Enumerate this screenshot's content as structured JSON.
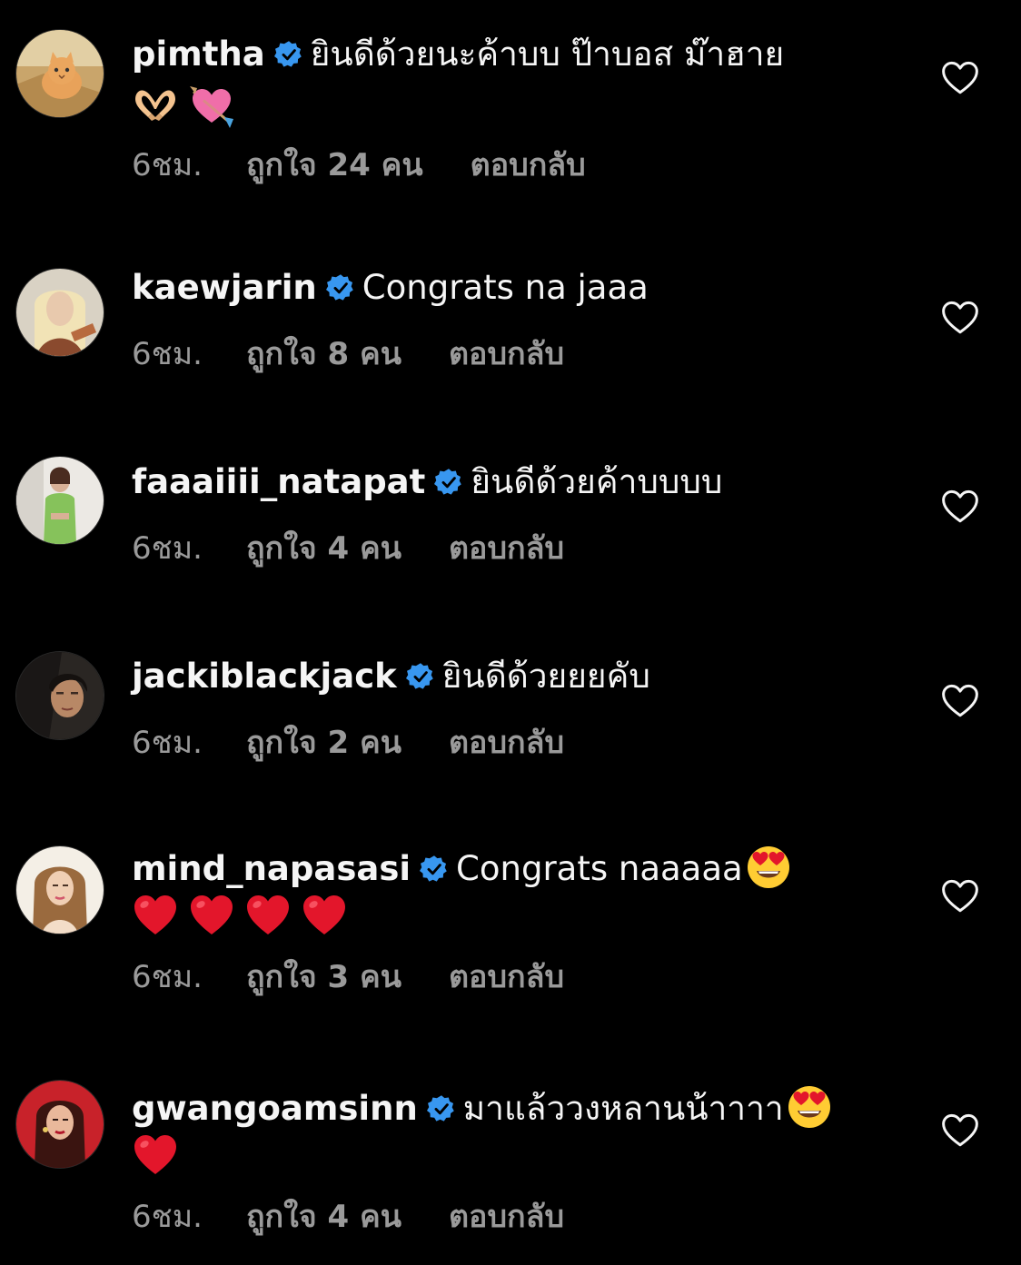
{
  "comments": [
    {
      "username": "pimtha",
      "text": "ยินดีด้วยนะค้าบบ ป๊าบอส ม๊าฮาย",
      "emojis_line2": [
        "heart-hands-emoji",
        "heart-with-arrow-emoji"
      ],
      "time": "6ชม.",
      "likes": "ถูกใจ 24 คน",
      "reply": "ตอบกลับ"
    },
    {
      "username": "kaewjarin",
      "text": "Congrats na jaaa",
      "time": "6ชม.",
      "likes": "ถูกใจ 8 คน",
      "reply": "ตอบกลับ"
    },
    {
      "username": "faaaiiii_natapat",
      "text": "ยินดีด้วยค้าบบบบ",
      "time": "6ชม.",
      "likes": "ถูกใจ 4 คน",
      "reply": "ตอบกลับ"
    },
    {
      "username": "jackiblackjack",
      "text": "ยินดีด้วยยยคับ",
      "time": "6ชม.",
      "likes": "ถูกใจ 2 คน",
      "reply": "ตอบกลับ"
    },
    {
      "username": "mind_napasasi",
      "text": "Congrats naaaaa",
      "emojis_inline": [
        "heart-eyes-emoji"
      ],
      "emojis_line2": [
        "red-heart-emoji",
        "red-heart-emoji",
        "red-heart-emoji",
        "red-heart-emoji"
      ],
      "time": "6ชม.",
      "likes": "ถูกใจ 3 คน",
      "reply": "ตอบกลับ"
    },
    {
      "username": "gwangoamsinn",
      "text": "มาแล้ววงหลานน้าาาา",
      "emojis_inline": [
        "heart-eyes-emoji"
      ],
      "emojis_line2": [
        "red-heart-emoji"
      ],
      "time": "6ชม.",
      "likes": "ถูกใจ 4 คน",
      "reply": "ตอบกลับ"
    }
  ],
  "colors": {
    "background": "#000000",
    "text": "#f5f5f5",
    "meta": "#9a9a9a",
    "verified": "#3897f0"
  }
}
